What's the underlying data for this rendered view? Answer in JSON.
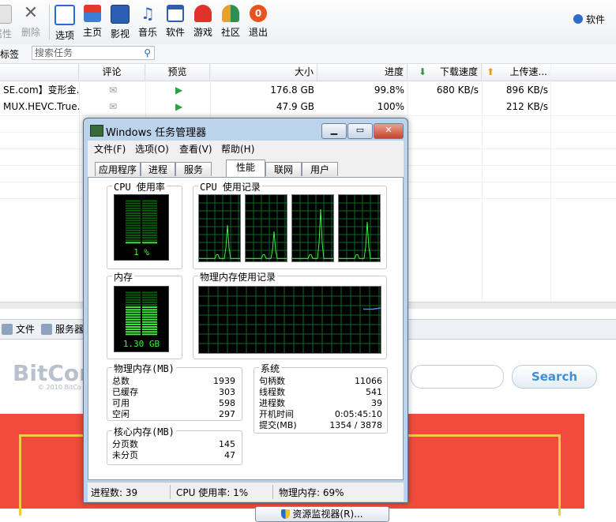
{
  "toolbar": {
    "items": [
      {
        "label": "属性",
        "state": "disabled",
        "icon": "properties-icon"
      },
      {
        "label": "删除",
        "state": "disabled",
        "icon": "delete-icon"
      },
      {
        "label": "选项",
        "icon": "options-icon"
      },
      {
        "label": "主页",
        "icon": "home-icon"
      },
      {
        "label": "影视",
        "icon": "movie-icon"
      },
      {
        "label": "音乐",
        "icon": "music-icon"
      },
      {
        "label": "软件",
        "icon": "software-icon"
      },
      {
        "label": "游戏",
        "icon": "game-icon"
      },
      {
        "label": "社区",
        "icon": "community-icon"
      },
      {
        "label": "退出",
        "icon": "exit-icon"
      }
    ],
    "right_label": "软件"
  },
  "filter": {
    "tag_label": "标签",
    "search_placeholder": "搜索任务"
  },
  "columns": [
    "评论",
    "预览",
    "大小",
    "进度",
    "下载速度",
    "上传速..."
  ],
  "rows": [
    {
      "name": "SE.com】变形金...",
      "size": "176.8 GB",
      "progress": "99.8%",
      "down": "680 KB/s",
      "up": "896 KB/s"
    },
    {
      "name": "MUX.HEVC.True...",
      "size": "47.9 GB",
      "progress": "100%",
      "down": "",
      "up": "212 KB/s"
    }
  ],
  "bottom_tabs": [
    "文件",
    "服务器"
  ],
  "ad": {
    "logo": "BitCom",
    "logo_sub": "© 2010 BitCo",
    "search_button": "Search"
  },
  "taskmgr": {
    "title": "Windows 任务管理器",
    "menu": [
      "文件(F)",
      "选项(O)",
      "查看(V)",
      "帮助(H)"
    ],
    "tabs": [
      "应用程序",
      "进程",
      "服务",
      "性能",
      "联网",
      "用户"
    ],
    "active_tab": "性能",
    "cpu_usage_label": "CPU 使用率",
    "cpu_usage_value": "1 %",
    "cpu_usage_percent": 1,
    "cpu_history_label": "CPU 使用记录",
    "mem_label": "内存",
    "mem_value": "1.30 GB",
    "mem_history_label": "物理内存使用记录",
    "physical": {
      "label": "物理内存(MB)",
      "rows": [
        [
          "总数",
          "1939"
        ],
        [
          "已缓存",
          "303"
        ],
        [
          "可用",
          "598"
        ],
        [
          "空闲",
          "297"
        ]
      ]
    },
    "kernel": {
      "label": "核心内存(MB)",
      "rows": [
        [
          "分页数",
          "145"
        ],
        [
          "未分页",
          "47"
        ]
      ]
    },
    "system": {
      "label": "系统",
      "rows": [
        [
          "句柄数",
          "11066"
        ],
        [
          "线程数",
          "541"
        ],
        [
          "进程数",
          "39"
        ],
        [
          "开机时间",
          "0:05:45:10"
        ],
        [
          "提交(MB)",
          "1354 / 3878"
        ]
      ]
    },
    "resource_button": "资源监视器(R)...",
    "status": [
      "进程数: 39",
      "CPU 使用率: 1%",
      "物理内存: 69%"
    ]
  }
}
